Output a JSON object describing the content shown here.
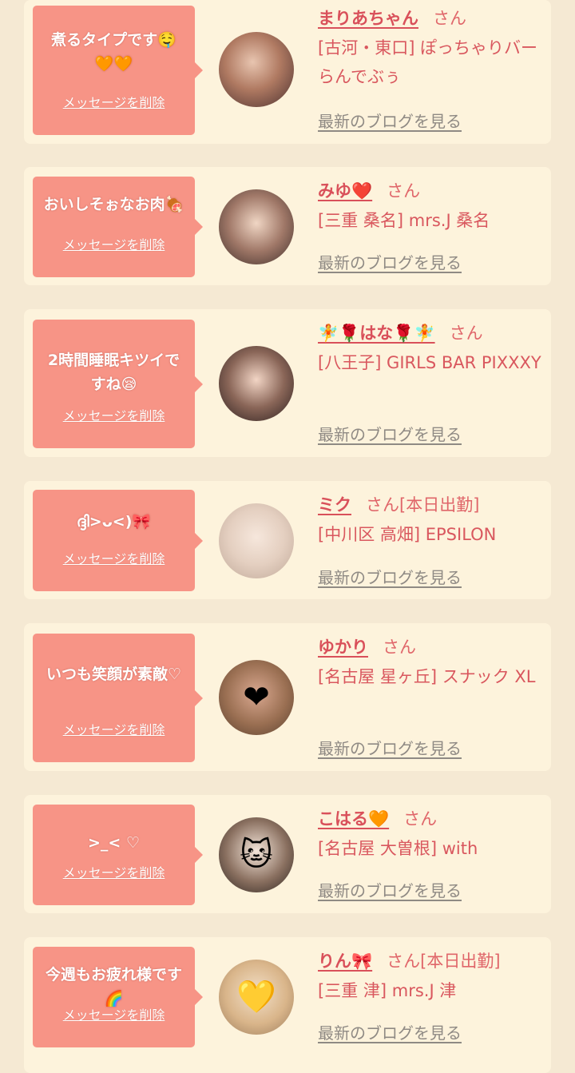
{
  "colors": {
    "page_background": "#f5e9d3",
    "card_background": "#fdf3dc",
    "bubble_background": "#f79486",
    "name_text": "#d9505a",
    "shop_text": "#d9575e",
    "blog_link": "#8f8a84"
  },
  "cards": [
    {
      "message": "煮るタイプです🤤🧡🧡",
      "delete_label": "メッセージを削除",
      "name": "まりあちゃん",
      "honorific": "さん",
      "status": "",
      "shop": "[古河・東口] ぽっちゃりバー らんでぶぅ",
      "blog_label": "最新のブログを見る",
      "avatar_icon": "",
      "avatar_decoration": ""
    },
    {
      "message": "おいしそぉなお肉🍖",
      "delete_label": "メッセージを削除",
      "name": "みゆ❤️",
      "honorific": "さん",
      "status": "",
      "shop": "[三重 桑名] mrs.J 桑名",
      "blog_label": "最新のブログを見る",
      "avatar_icon": "",
      "avatar_decoration": ""
    },
    {
      "message": "2時間睡眠キツイですね😪",
      "delete_label": "メッセージを削除",
      "name": "🧚🌹はな🌹🧚",
      "honorific": "さん",
      "status": "",
      "shop": "[八王子] GIRLS BAR PIXXXY",
      "blog_label": "最新のブログを見る",
      "avatar_icon": "",
      "avatar_decoration": ""
    },
    {
      "message": "ദ്ദി>ᴗ<)🎀",
      "delete_label": "メッセージを削除",
      "name": "ミク",
      "honorific": "さん",
      "status": "[本日出勤]",
      "shop": "[中川区 高畑] EPSILON",
      "blog_label": "最新のブログを見る",
      "avatar_icon": "",
      "avatar_decoration": ""
    },
    {
      "message": "いつも笑顔が素敵♡",
      "delete_label": "メッセージを削除",
      "name": "ゆかり",
      "honorific": "さん",
      "status": "",
      "shop": "[名古屋 星ヶ丘] スナック XL",
      "blog_label": "最新のブログを見る",
      "avatar_icon": "heart-sticker-icon",
      "avatar_decoration": "❤"
    },
    {
      "message": ">_< ♡",
      "delete_label": "メッセージを削除",
      "name": "こはる🧡",
      "honorific": "さん",
      "status": "",
      "shop": "[名古屋 大曽根] with",
      "blog_label": "最新のブログを見る",
      "avatar_icon": "cat-sticker-icon",
      "avatar_decoration": "🐱"
    },
    {
      "message": "今週もお疲れ様です🌈",
      "delete_label": "メッセージを削除",
      "name": "りん🎀",
      "honorific": "さん",
      "status": "[本日出勤]",
      "shop": "[三重 津] mrs.J 津",
      "blog_label": "最新のブログを見る",
      "avatar_icon": "yellow-heart-sticker-icon",
      "avatar_decoration": "💛"
    }
  ]
}
